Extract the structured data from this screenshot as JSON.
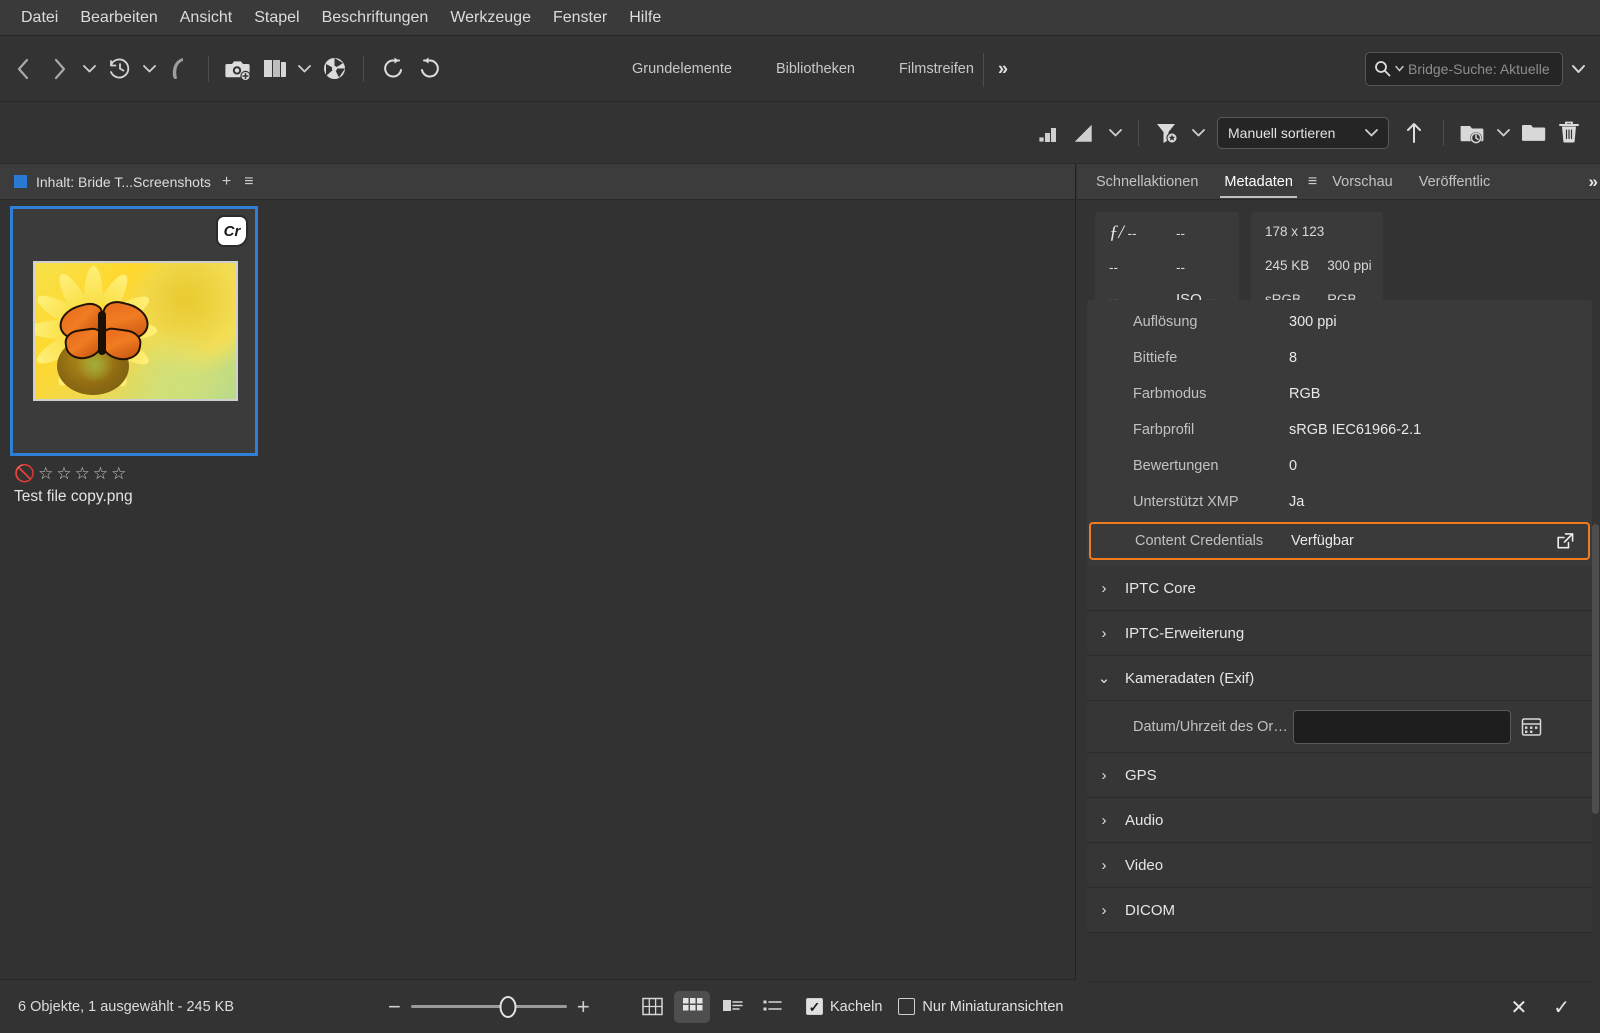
{
  "menubar": {
    "items": [
      {
        "label": "Datei"
      },
      {
        "label": "Bearbeiten"
      },
      {
        "label": "Ansicht"
      },
      {
        "label": "Stapel"
      },
      {
        "label": "Beschriftungen"
      },
      {
        "label": "Werkzeuge"
      },
      {
        "label": "Fenster"
      },
      {
        "label": "Hilfe"
      }
    ]
  },
  "toolbar": {
    "workspace_tabs": [
      {
        "label": "Grundelemente"
      },
      {
        "label": "Bibliotheken"
      },
      {
        "label": "Filmstreifen"
      }
    ],
    "overflow_label": "»",
    "search": {
      "placeholder": "Bridge-Suche: Aktuelle",
      "icon": "search-icon"
    },
    "icons": [
      "back-arrow-icon",
      "forward-arrow-icon",
      "chevron-down-icon",
      "history-clock-icon",
      "boomerang-icon",
      "get-photos-camera-icon",
      "copy-stack-icon",
      "camera-raw-aperture-icon",
      "rotate-counterclockwise-icon",
      "rotate-clockwise-icon"
    ]
  },
  "toolbar2": {
    "sort_value": "Manuell sortieren",
    "icons": [
      "filter-ratings-icon",
      "filter-chevron-icon",
      "filter-funnel-icon",
      "sort-ascending-arrow-icon",
      "recent-folder-icon",
      "new-folder-icon",
      "delete-trash-icon"
    ]
  },
  "content_pane": {
    "tab_title": "Inhalt: Bride T...Screenshots",
    "add_label": "+",
    "menu_label": "≡",
    "thumbnail": {
      "filename": "Test file copy.png",
      "badge": "Cr",
      "rating_stars": 5,
      "rating_value": 0,
      "reject_icon": "reject-circle-icon"
    }
  },
  "statusbar": {
    "text": "6 Objekte, 1 ausgewählt - 245 KB",
    "zoom_minus": "−",
    "zoom_plus": "+",
    "zoom_position_pct": 62,
    "view_modes": [
      {
        "name": "grid-view-icon",
        "active": false
      },
      {
        "name": "thumbnail-grid-view-icon",
        "active": true
      },
      {
        "name": "details-view-icon",
        "active": false
      },
      {
        "name": "list-view-icon",
        "active": false
      }
    ],
    "checkboxes": [
      {
        "label": "Kacheln",
        "checked": true
      },
      {
        "label": "Nur Miniaturansichten",
        "checked": false
      }
    ]
  },
  "metadata_pane": {
    "tabs": [
      {
        "label": "Schnellaktionen",
        "active": false
      },
      {
        "label": "Metadaten",
        "active": true
      },
      {
        "label": "Vorschau",
        "active": false
      },
      {
        "label": "Veröffentlic",
        "active": false
      }
    ],
    "tab_menu_label": "≡",
    "overflow_label": "»",
    "placard": {
      "left": {
        "aperture_label": "ƒ/",
        "aperture_value": "--",
        "shutter_value": "--",
        "row2_a": "--",
        "row2_b": "--",
        "row3_a": "--",
        "iso_label": "ISO",
        "iso_value": "--"
      },
      "right": {
        "dimensions": "178 x 123",
        "filesize": "245 KB",
        "resolution": "300 ppi",
        "color_space": "sRGB",
        "color_mode": "RGB"
      }
    },
    "properties": [
      {
        "key": "Auflösung",
        "value": "300 ppi",
        "highlight": false
      },
      {
        "key": "Bittiefe",
        "value": "8",
        "highlight": false
      },
      {
        "key": "Farbmodus",
        "value": "RGB",
        "highlight": false
      },
      {
        "key": "Farbprofil",
        "value": "sRGB IEC61966-2.1",
        "highlight": false
      },
      {
        "key": "Bewertungen",
        "value": "0",
        "highlight": false
      },
      {
        "key": "Unterstützt XMP",
        "value": "Ja",
        "highlight": false
      },
      {
        "key": "Content Credentials",
        "value": "Verfügbar",
        "highlight": true
      }
    ],
    "sections": [
      {
        "label": "IPTC Core",
        "expanded": false
      },
      {
        "label": "IPTC-Erweiterung",
        "expanded": false
      },
      {
        "label": "Kameradaten (Exif)",
        "expanded": true
      },
      {
        "label": "GPS",
        "expanded": false
      },
      {
        "label": "Audio",
        "expanded": false
      },
      {
        "label": "Video",
        "expanded": false
      },
      {
        "label": "DICOM",
        "expanded": false
      }
    ],
    "exif_field": {
      "key": "Datum/Uhrzeit des Or…",
      "value": "",
      "calendar_icon": "calendar-icon"
    },
    "footer": {
      "cancel_label": "✕",
      "confirm_label": "✓"
    }
  },
  "colors": {
    "highlight_orange": "#f07c22",
    "selection_blue": "#2f7fd6",
    "panel_bg": "#333333",
    "card_bg": "#3a3a3a"
  }
}
